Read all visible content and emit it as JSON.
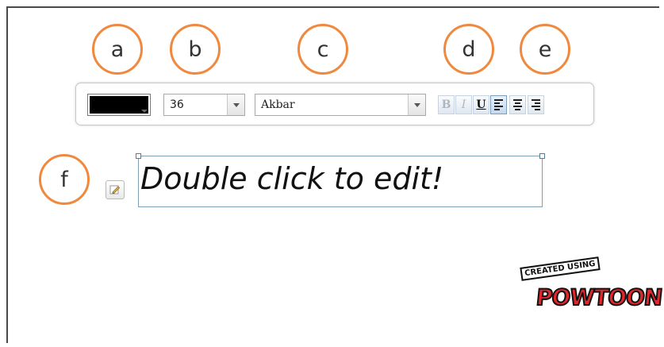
{
  "badges": {
    "a": "a",
    "b": "b",
    "c": "c",
    "d": "d",
    "e": "e",
    "f": "f"
  },
  "toolbar": {
    "color_swatch": "#000000",
    "font_size": "36",
    "font_family": "Akbar",
    "bold_label": "B",
    "italic_label": "I",
    "underline_label": "U",
    "align_left_icon": "align-left-icon",
    "align_center_icon": "align-center-icon",
    "align_right_icon": "align-right-icon"
  },
  "textbox": {
    "text": "Double click to edit!"
  },
  "edit_icon": "edit-pencil-icon",
  "logo": {
    "top": "CREATED USING",
    "word": "POWTOON"
  },
  "colors": {
    "badge_ring": "#f0883e",
    "textbox_border": "#7f9fb4",
    "logo_red": "#e2262c"
  }
}
